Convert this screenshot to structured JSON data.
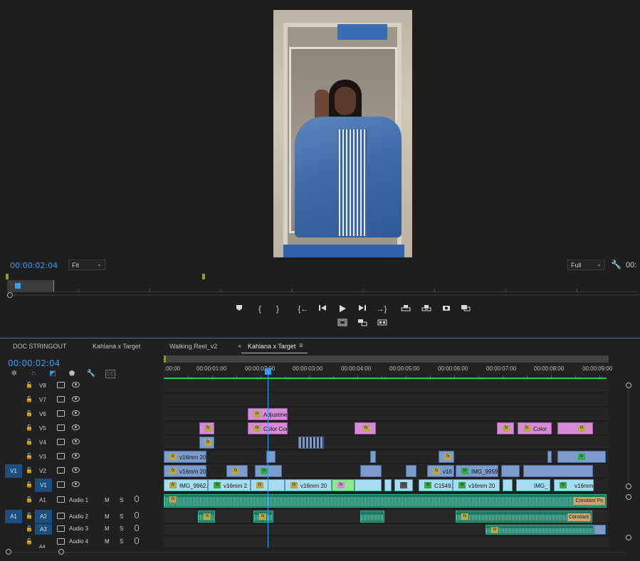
{
  "monitor": {
    "timecode": "00:00:02:04",
    "zoom_fit": "Fit",
    "resolution": "Full",
    "timecode_right": "00:"
  },
  "timeline": {
    "tabs": [
      {
        "label": "DOC STRINGOUT"
      },
      {
        "label": "Kahlana x Target"
      },
      {
        "label": "Walking Reel_v2"
      },
      {
        "label": "Kahlana x Target"
      }
    ],
    "tab_close": "×",
    "tab_menu": "≡",
    "timecode": "00:00:02:04",
    "ruler_labels": [
      ":00:00",
      "00:00:01:00",
      "00:00:02:00",
      "00:00:03:00",
      "00:00:04:00",
      "00:00:05:00",
      "00:00:06:00",
      "00:00:07:00",
      "00:00:08:00",
      "00:00:09:00"
    ],
    "video_tracks": [
      "V8",
      "V7",
      "V6",
      "V5",
      "V4",
      "V3",
      "V2",
      "V1"
    ],
    "source_v": "V1",
    "source_a": "A1",
    "audio_tracks": [
      {
        "id": "A1",
        "name": "Audio 1"
      },
      {
        "id": "A2",
        "name": "Audio 2"
      },
      {
        "id": "A3",
        "name": "Audio 3"
      },
      {
        "id": "A4",
        "name": "Audio 4"
      }
    ],
    "mute_label": "M",
    "solo_label": "S",
    "clips": {
      "v6_adjust": "Adjustme",
      "v5_color1": "Color Cor",
      "v5_color2": "Color",
      "v3_1": "v16mm 20",
      "v2_1": "v16mm 20",
      "v2_2": "v16",
      "v2_3": "IMG_9959",
      "v1_1": "IMG_9962.",
      "v1_2": "v16mm 2",
      "v1_3": "v16mm 20",
      "v1_4": "C1549.M",
      "v1_5": "v16mm 20",
      "v1_6": "IMG_",
      "v1_7": "v16mm",
      "a1_label": "Constant Po",
      "a2_label": "Constant"
    },
    "fx": "fx"
  }
}
